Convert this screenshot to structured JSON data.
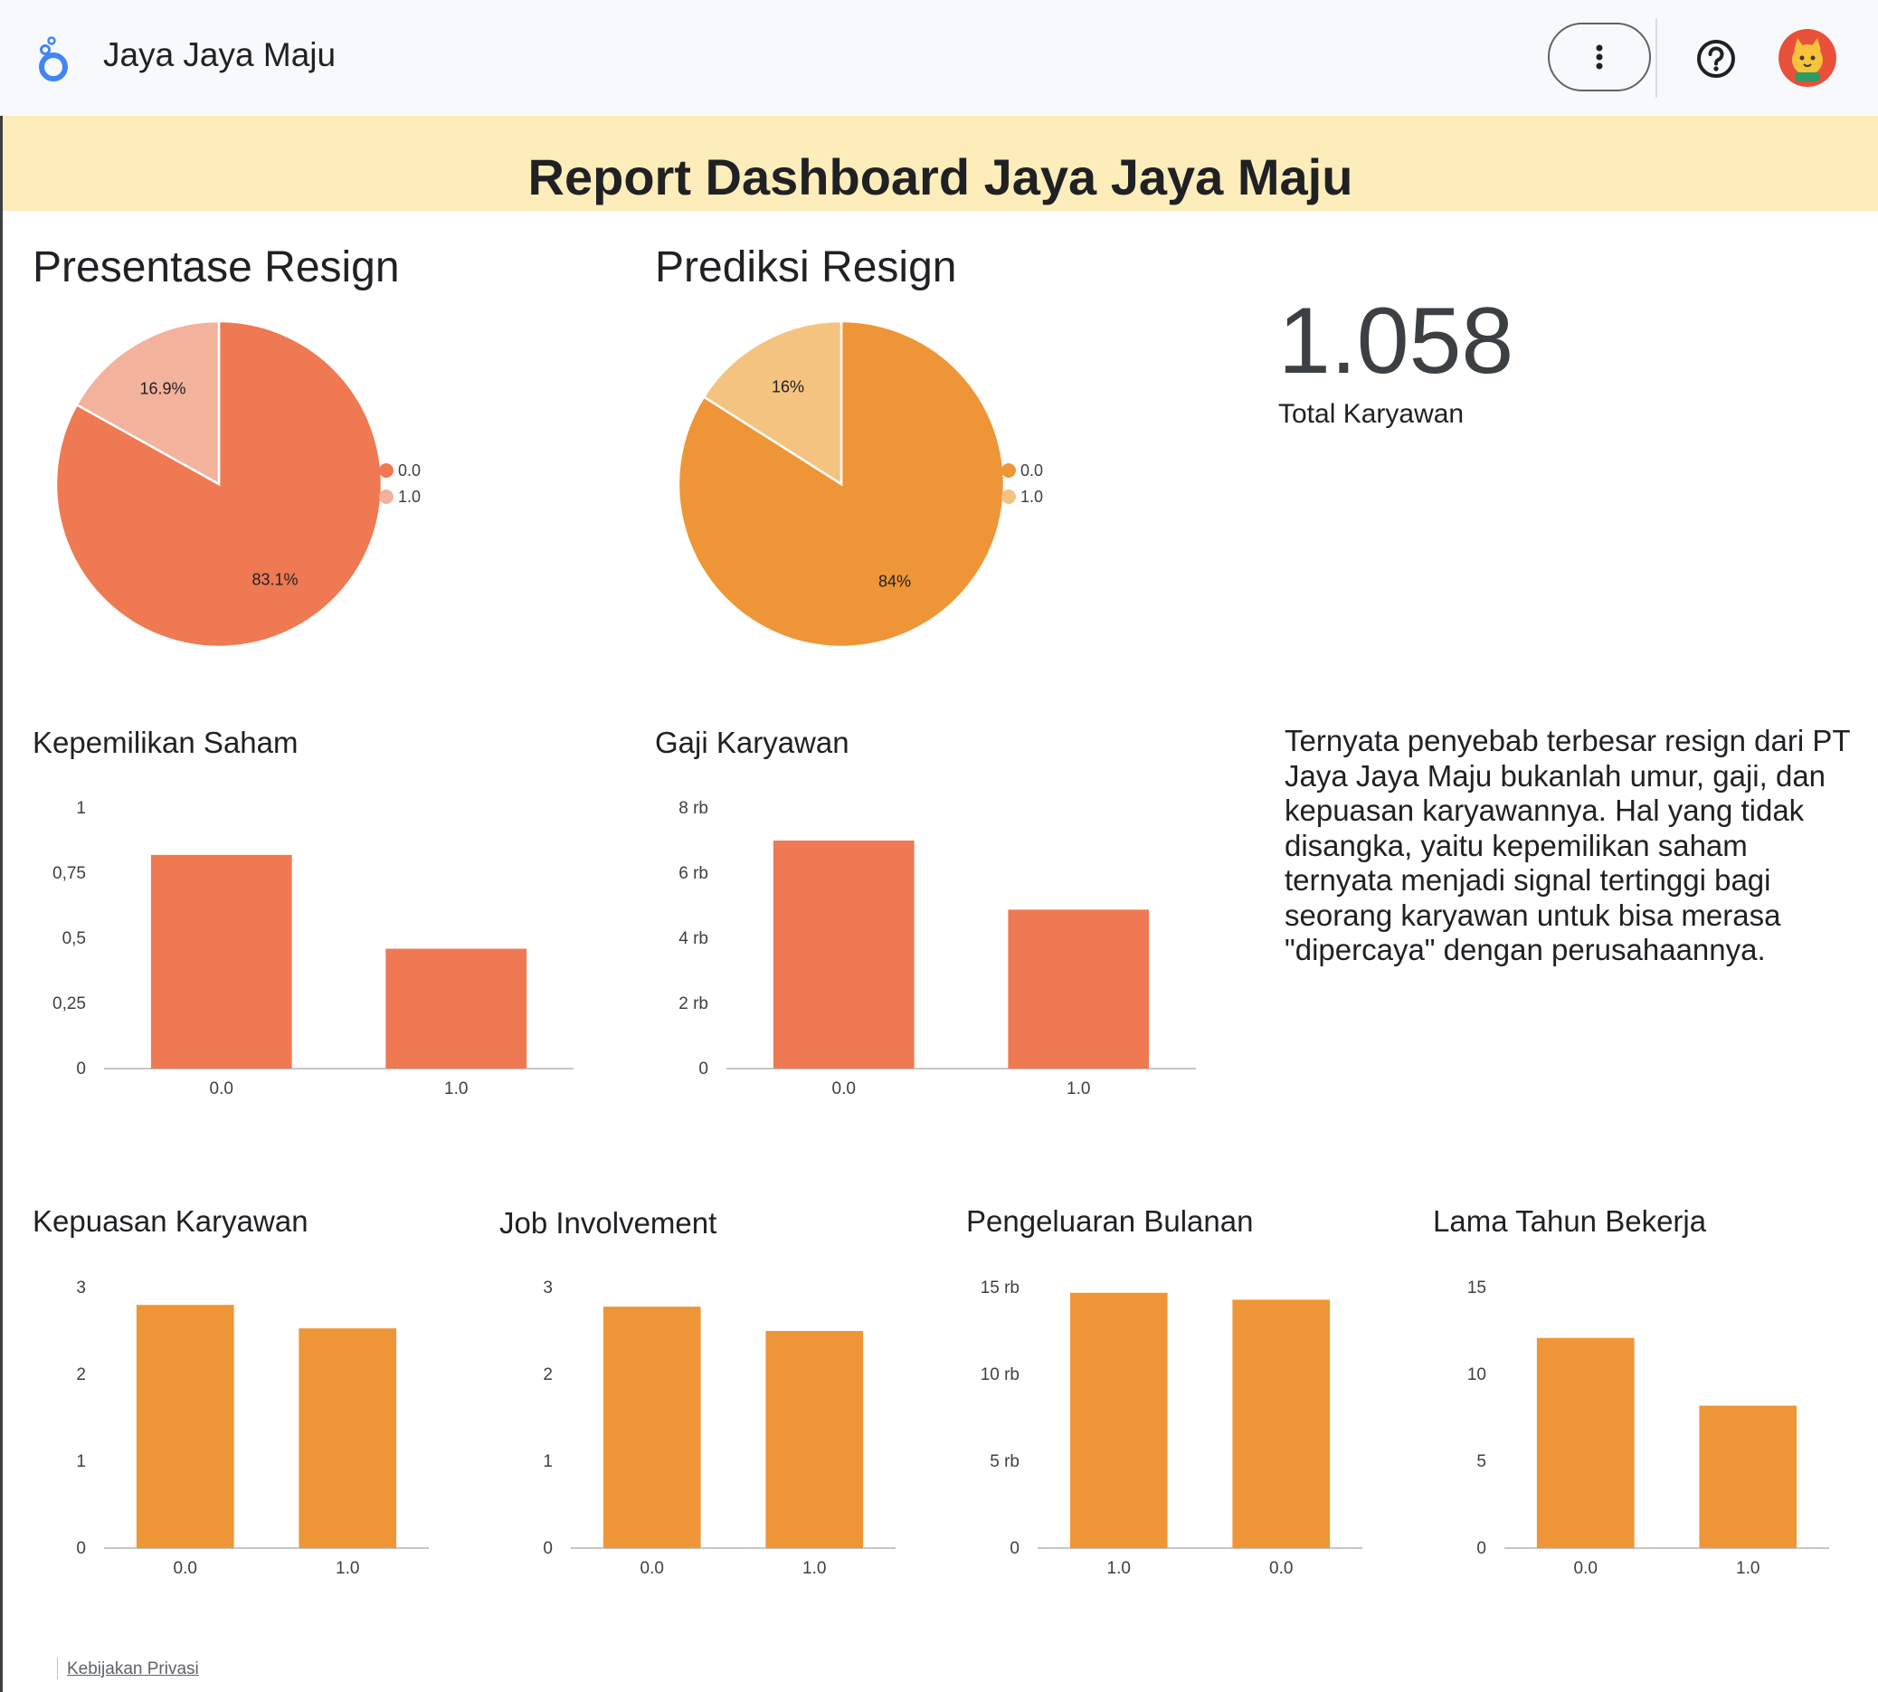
{
  "app": {
    "title": "Jaya Jaya Maju"
  },
  "banner": {
    "title": "Report Dashboard Jaya Jaya Maju"
  },
  "icons": {
    "logo": "looker-studio-logo-icon",
    "more": "more-vert-icon",
    "help": "help-icon",
    "avatar": "user-avatar"
  },
  "colors": {
    "banner_bg": "#fdedbb",
    "bar_red": "#ee7952",
    "bar_orange": "#ee9637",
    "pie1_main": "#ee7952",
    "pie1_second": "#f3b29c",
    "pie2_main": "#ee9637",
    "pie2_second": "#f5c380"
  },
  "kpi": {
    "value": "1.058",
    "label": "Total Karyawan"
  },
  "insight": {
    "text": "Ternyata penyebab terbesar resign dari PT Jaya Jaya Maju bukanlah umur, gaji, dan kepuasan karyawannya. Hal yang tidak disangka, yaitu kepemilikan saham ternyata menjadi signal tertinggi bagi seorang karyawan untuk bisa merasa \"dipercaya\" dengan perusahaannya."
  },
  "footer": {
    "privacy_label": "Kebijakan Privasi"
  },
  "chart_data": [
    {
      "id": "presentase-resign",
      "type": "pie",
      "title": "Presentase Resign",
      "labels": [
        "0.0",
        "1.0"
      ],
      "values": [
        83.1,
        16.9
      ],
      "value_labels": [
        "83.1%",
        "16.9%"
      ],
      "colors": [
        "#ee7952",
        "#f3b29c"
      ],
      "legend": "right"
    },
    {
      "id": "prediksi-resign",
      "type": "pie",
      "title": "Prediksi Resign",
      "labels": [
        "0.0",
        "1.0"
      ],
      "values": [
        84,
        16
      ],
      "value_labels": [
        "84%",
        "16%"
      ],
      "colors": [
        "#ee9637",
        "#f5c380"
      ],
      "legend": "right"
    },
    {
      "id": "kepemilikan-saham",
      "type": "bar",
      "title": "Kepemilikan Saham",
      "categories": [
        "0.0",
        "1.0"
      ],
      "values": [
        0.82,
        0.46
      ],
      "ylim": [
        0,
        1
      ],
      "yticks": [
        0,
        0.25,
        0.5,
        0.75,
        1
      ],
      "ytick_labels": [
        "0",
        "0,25",
        "0,5",
        "0,75",
        "1"
      ],
      "color": "#ee7952"
    },
    {
      "id": "gaji-karyawan",
      "type": "bar",
      "title": "Gaji Karyawan",
      "categories": [
        "0.0",
        "1.0"
      ],
      "values": [
        7000,
        4880
      ],
      "ylim": [
        0,
        8000
      ],
      "yticks": [
        0,
        2000,
        4000,
        6000,
        8000
      ],
      "ytick_labels": [
        "0",
        "2 rb",
        "4 rb",
        "6 rb",
        "8 rb"
      ],
      "color": "#ee7952"
    },
    {
      "id": "kepuasan-karyawan",
      "type": "bar",
      "title": "Kepuasan Karyawan",
      "categories": [
        "0.0",
        "1.0"
      ],
      "values": [
        2.8,
        2.53
      ],
      "ylim": [
        0,
        3
      ],
      "yticks": [
        0,
        1,
        2,
        3
      ],
      "ytick_labels": [
        "0",
        "1",
        "2",
        "3"
      ],
      "color": "#ee9637"
    },
    {
      "id": "job-involvement",
      "type": "bar",
      "title": "Job Involvement",
      "categories": [
        "0.0",
        "1.0"
      ],
      "values": [
        2.78,
        2.5
      ],
      "ylim": [
        0,
        3
      ],
      "yticks": [
        0,
        1,
        2,
        3
      ],
      "ytick_labels": [
        "0",
        "1",
        "2",
        "3"
      ],
      "color": "#ee9637"
    },
    {
      "id": "pengeluaran-bulanan",
      "type": "bar",
      "title": "Pengeluaran Bulanan",
      "categories": [
        "1.0",
        "0.0"
      ],
      "values": [
        14700,
        14300
      ],
      "ylim": [
        0,
        15000
      ],
      "yticks": [
        0,
        5000,
        10000,
        15000
      ],
      "ytick_labels": [
        "0",
        "5 rb",
        "10 rb",
        "15 rb"
      ],
      "color": "#ee9637"
    },
    {
      "id": "lama-tahun-bekerja",
      "type": "bar",
      "title": "Lama Tahun Bekerja",
      "categories": [
        "0.0",
        "1.0"
      ],
      "values": [
        12.1,
        8.2
      ],
      "ylim": [
        0,
        15
      ],
      "yticks": [
        0,
        5,
        10,
        15
      ],
      "ytick_labels": [
        "0",
        "5",
        "10",
        "15"
      ],
      "color": "#ee9637"
    }
  ]
}
